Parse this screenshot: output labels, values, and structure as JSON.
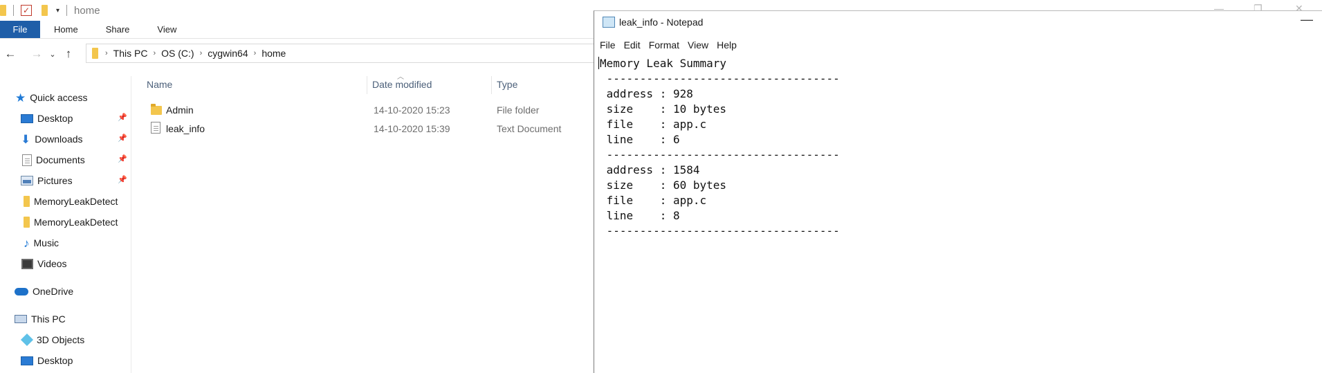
{
  "explorer": {
    "window_title": "home",
    "ribbon_tabs": [
      "File",
      "Home",
      "Share",
      "View"
    ],
    "breadcrumb": [
      "This PC",
      "OS (C:)",
      "cygwin64",
      "home"
    ],
    "nav": {
      "quick_access": "Quick access",
      "items": [
        "Desktop",
        "Downloads",
        "Documents",
        "Pictures",
        "MemoryLeakDetect",
        "MemoryLeakDetect",
        "Music",
        "Videos"
      ],
      "onedrive": "OneDrive",
      "this_pc": "This PC",
      "pc_items": [
        "3D Objects",
        "Desktop"
      ]
    },
    "columns": {
      "name": "Name",
      "date": "Date modified",
      "type": "Type"
    },
    "files": [
      {
        "name": "Admin",
        "date": "14-10-2020 15:23",
        "type": "File folder",
        "icon": "folder-icon"
      },
      {
        "name": "leak_info",
        "date": "14-10-2020 15:39",
        "type": "Text Document",
        "icon": "text-file-icon"
      }
    ]
  },
  "notepad": {
    "title": "leak_info - Notepad",
    "menu": [
      "File",
      "Edit",
      "Format",
      "View",
      "Help"
    ],
    "lines": [
      "Memory Leak Summary",
      " -----------------------------------",
      " address : 928",
      " size    : 10 bytes",
      " file    : app.c",
      " line    : 6",
      " -----------------------------------",
      " address : 1584",
      " size    : 60 bytes",
      " file    : app.c",
      " line    : 8",
      " -----------------------------------"
    ]
  }
}
